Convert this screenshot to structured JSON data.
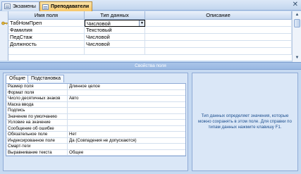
{
  "tabs": [
    {
      "label": "Экзамены",
      "active": false
    },
    {
      "label": "Преподаватели",
      "active": true
    }
  ],
  "grid": {
    "headers": [
      "Имя поля",
      "Тип данных",
      "Описание"
    ],
    "rows": [
      {
        "name": "ТабНомПреп",
        "type": "Числовой",
        "description": "",
        "key": true
      },
      {
        "name": "Фамилия",
        "type": "Текстовый",
        "description": "",
        "key": false
      },
      {
        "name": "ПедСтаж",
        "type": "Числовой",
        "description": "",
        "key": false
      },
      {
        "name": "Должность",
        "type": "Числовой",
        "description": "",
        "key": false
      }
    ]
  },
  "properties": {
    "title": "Свойства поля",
    "tabs": [
      "Общие",
      "Подстановка"
    ],
    "rows": [
      {
        "label": "Размер поля",
        "value": "Длинное целое"
      },
      {
        "label": "Формат поля",
        "value": ""
      },
      {
        "label": "Число десятичных знаков",
        "value": "Авто"
      },
      {
        "label": "Маска ввода",
        "value": ""
      },
      {
        "label": "Подпись",
        "value": ""
      },
      {
        "label": "Значение по умолчанию",
        "value": ""
      },
      {
        "label": "Условие на значение",
        "value": ""
      },
      {
        "label": "Сообщение об ошибке",
        "value": ""
      },
      {
        "label": "Обязательное поле",
        "value": "Нет"
      },
      {
        "label": "Индексированное поле",
        "value": "Да (Совпадения не допускаются)"
      },
      {
        "label": "Смарт-теги",
        "value": ""
      },
      {
        "label": "Выравнивание текста",
        "value": "Общее"
      }
    ],
    "help": "Тип данных определяет значения, которые можно сохранять в этом поле. Для справки по типам данных нажмите клавишу F1."
  },
  "colors": {
    "active_tab": "#f6c76a",
    "panel_bg": "#dae7f7",
    "help_text": "#1d4f8e"
  }
}
